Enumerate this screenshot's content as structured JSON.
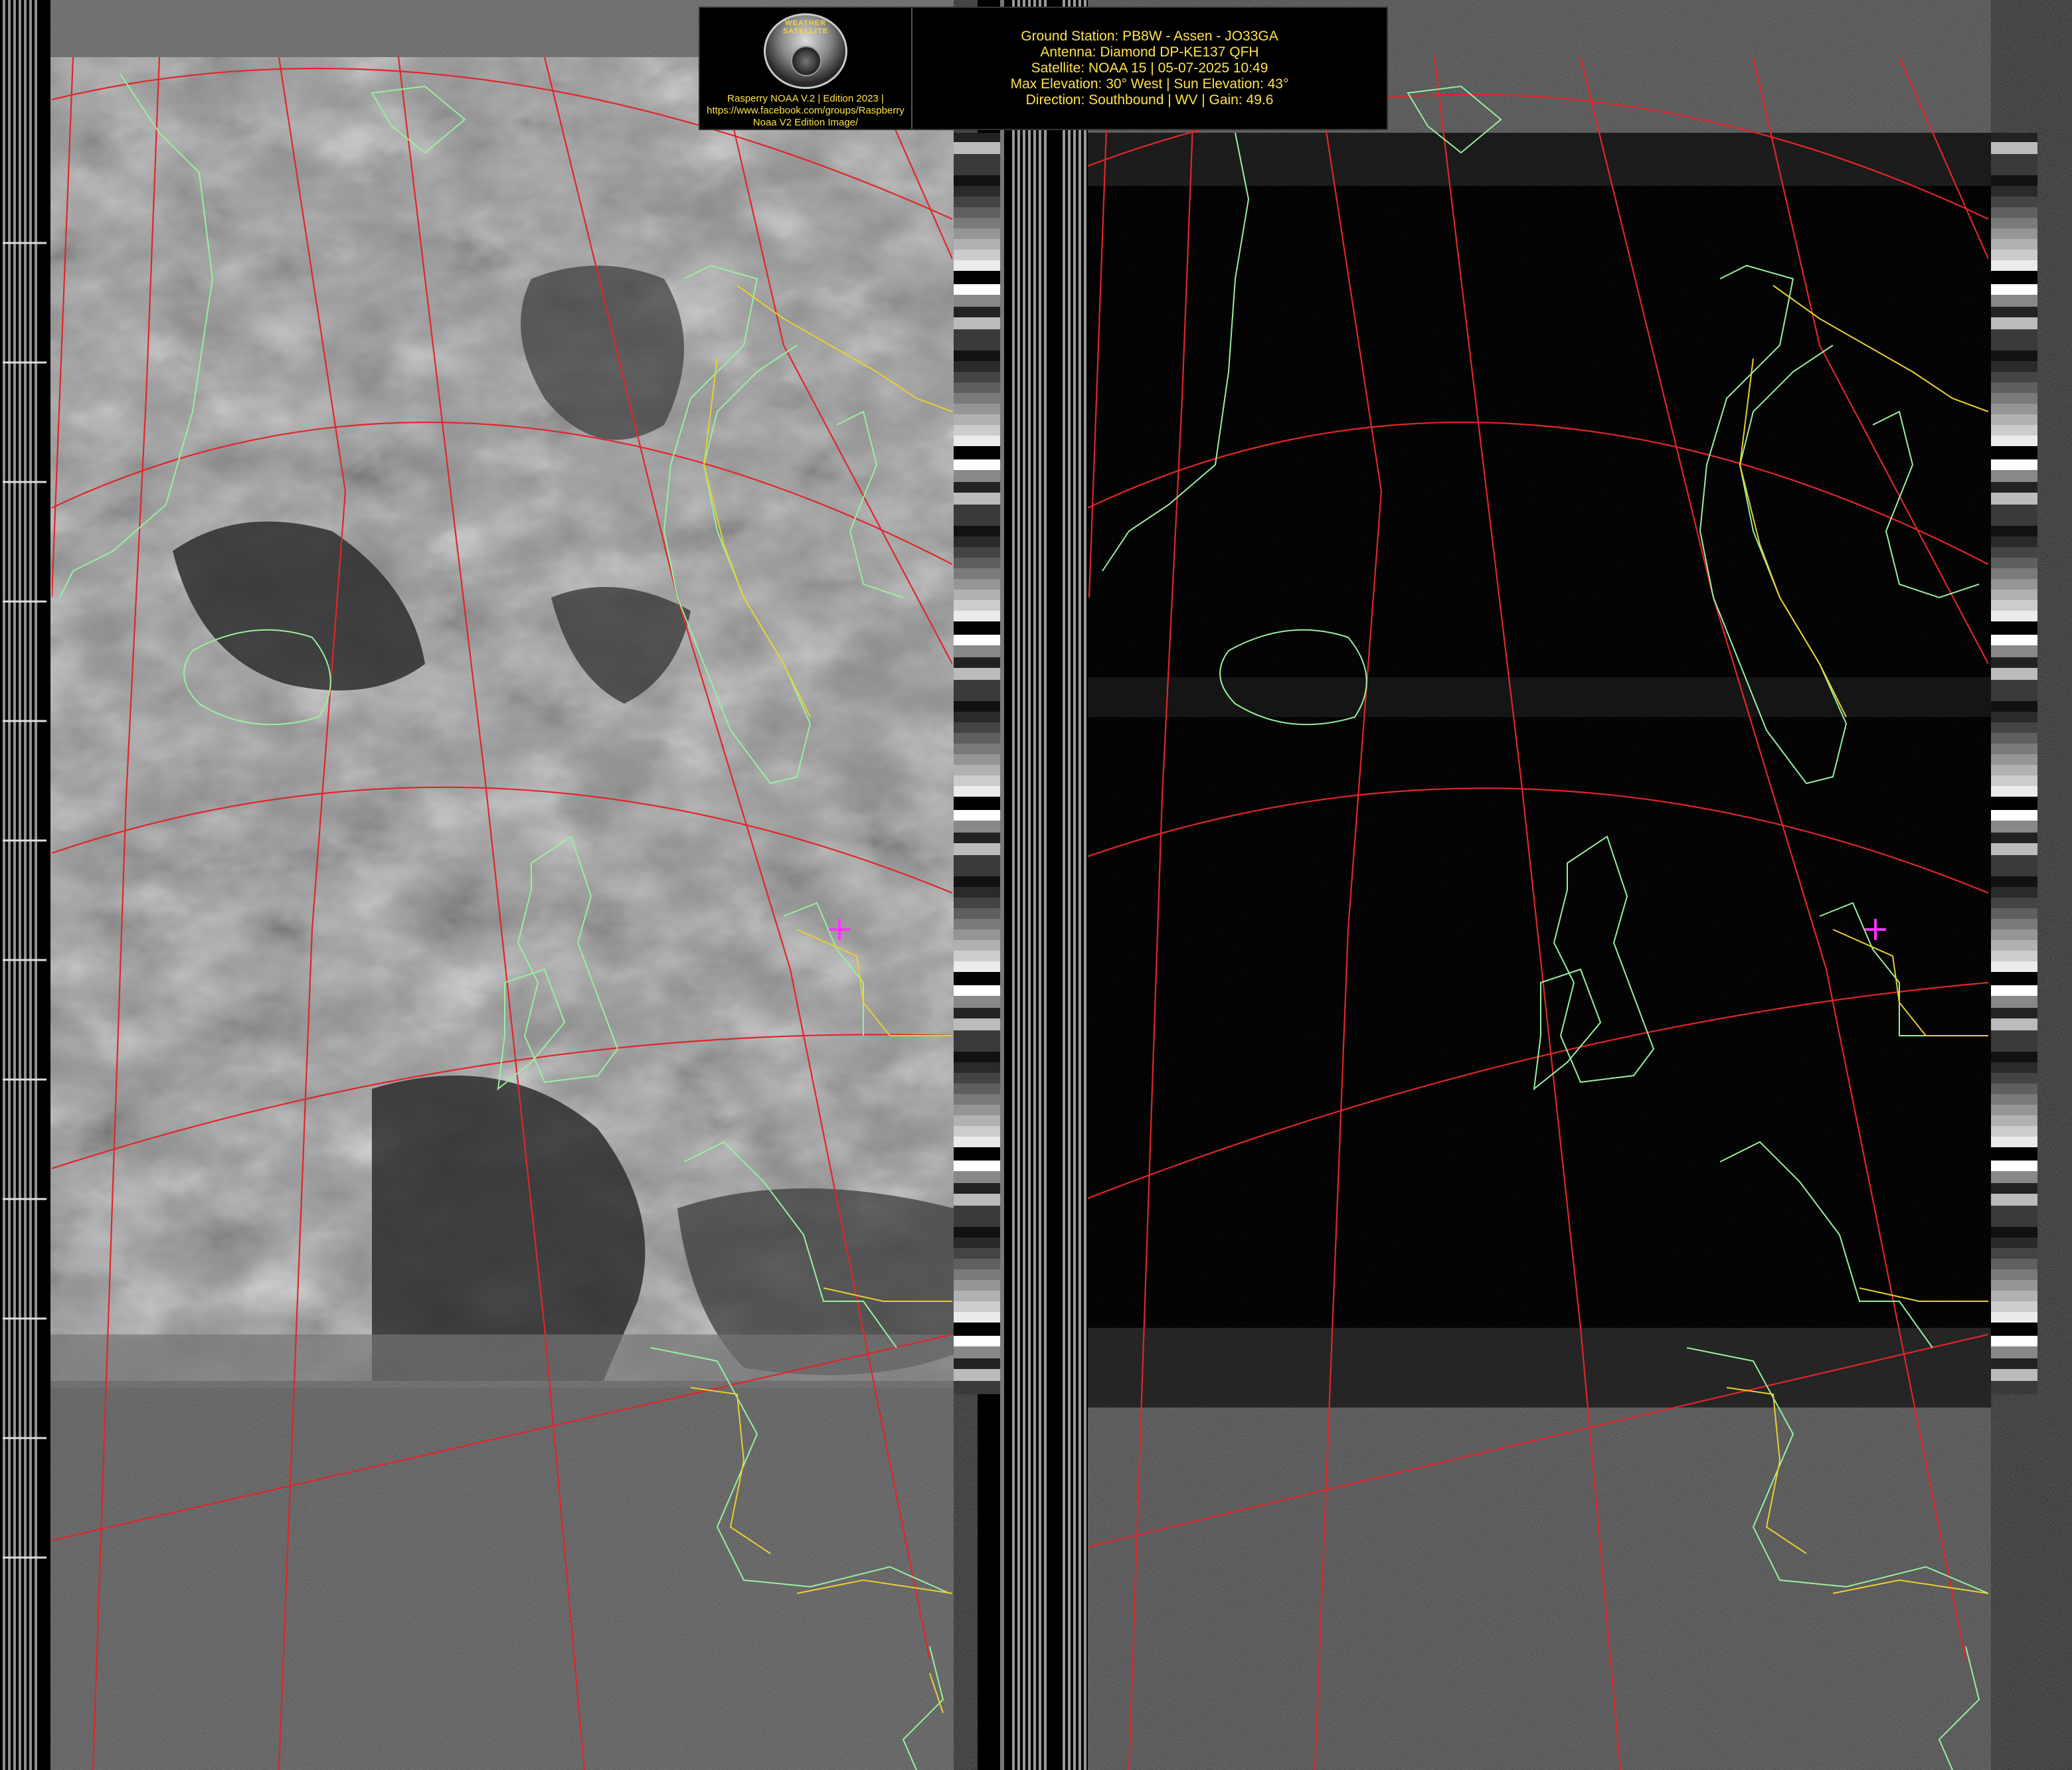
{
  "banner": {
    "logo_ring_text": "WEATHER SATELLITE",
    "credit_line_1": "Rasperry NOAA V.2 | Edition 2023 |",
    "credit_line_2": "https://www.facebook.com/groups/Raspberry",
    "credit_line_3": "Noaa V2 Edition Image/",
    "ground_station": "Ground Station: PB8W - Assen - JO33GA",
    "antenna": "Antenna: Diamond DP-KE137 QFH",
    "satellite": "Satellite: NOAA 15 | 05-07-2025 10:49",
    "elevation": "Max Elevation: 30° West | Sun Elevation: 43°",
    "direction": "Direction: Southbound | WV | Gain: 49.6"
  },
  "colors": {
    "grid": "#e0262a",
    "coast": "#98f0a0",
    "border": "#e8d030",
    "marker": "#ff33ff",
    "text": "#ffe24a"
  },
  "panels": [
    {
      "name": "visible-channel",
      "brightness": "light-gray"
    },
    {
      "name": "infrared-channel",
      "brightness": "dark"
    }
  ],
  "marker": {
    "symbol": "+",
    "location": "Assen"
  }
}
